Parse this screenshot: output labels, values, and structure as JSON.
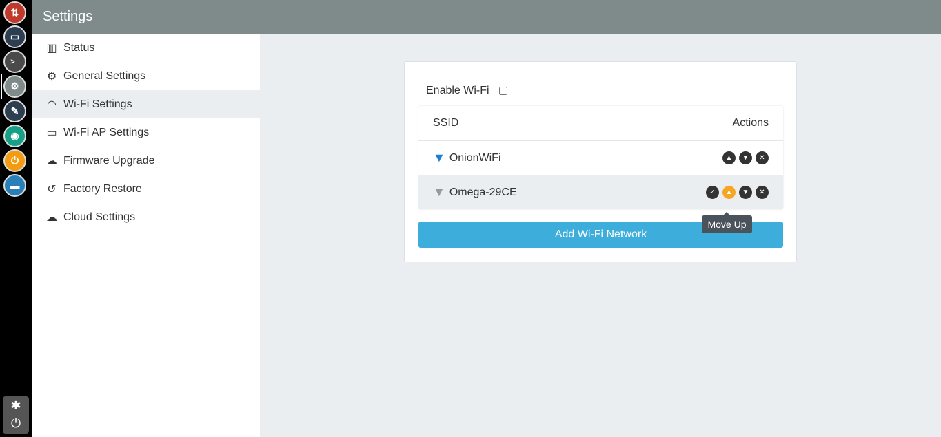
{
  "header": {
    "title": "Settings"
  },
  "dock": {
    "apps": [
      {
        "icon": "transfer-icon",
        "color": "#c0392b"
      },
      {
        "icon": "window-icon",
        "color": "#2c3e50"
      },
      {
        "icon": "terminal-icon",
        "color": "#4a4a4a",
        "glyph": ">_"
      },
      {
        "icon": "gear-icon",
        "color": "#7f8b8b"
      },
      {
        "icon": "pencil-icon",
        "color": "#2c3e50"
      },
      {
        "icon": "webcam-icon",
        "color": "#16a085"
      },
      {
        "icon": "power-icon",
        "color": "#f39c12"
      },
      {
        "icon": "folder-icon",
        "color": "#2980b9"
      }
    ]
  },
  "sidebar": {
    "items": [
      {
        "label": "Status",
        "icon": "bar-chart-icon"
      },
      {
        "label": "General Settings",
        "icon": "gear-icon"
      },
      {
        "label": "Wi-Fi Settings",
        "icon": "wifi-icon",
        "active": true
      },
      {
        "label": "Wi-Fi AP Settings",
        "icon": "router-icon"
      },
      {
        "label": "Firmware Upgrade",
        "icon": "cloud-download-icon"
      },
      {
        "label": "Factory Restore",
        "icon": "history-icon"
      },
      {
        "label": "Cloud Settings",
        "icon": "cloud-icon"
      }
    ]
  },
  "main": {
    "enable_label": "Enable Wi-Fi",
    "enable_checked": false,
    "table": {
      "col_ssid": "SSID",
      "col_actions": "Actions",
      "rows": [
        {
          "ssid": "OnionWiFi",
          "connected": true
        },
        {
          "ssid": "Omega-29CE",
          "connected": false
        }
      ]
    },
    "add_label": "Add Wi-Fi Network",
    "tooltip": "Move Up"
  },
  "colors": {
    "accent": "#3daedb",
    "highlight": "#f5a623",
    "header": "#7f8b8b"
  }
}
